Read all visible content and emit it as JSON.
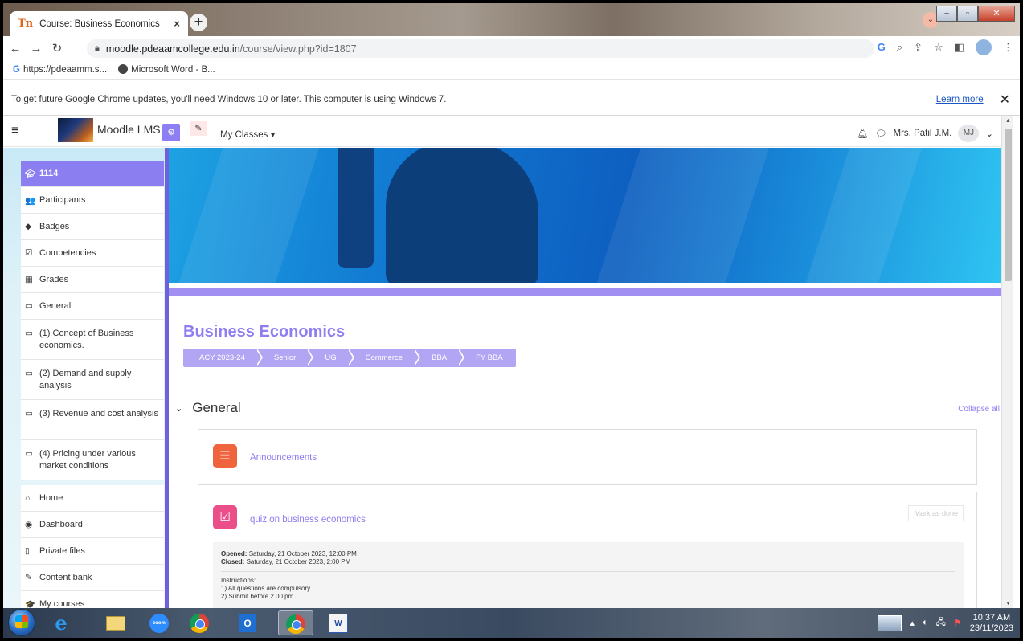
{
  "browser": {
    "tab_title": "Course: Business Economics",
    "tab_favicon": "Tn",
    "tab_close": "×",
    "new_tab": "+",
    "url_host": "moodle.pdeaamcollege.edu.in",
    "url_path": "/course/view.php?id=1807",
    "bookmarks": [
      {
        "label": "https://pdeaamm.s..."
      },
      {
        "label": "Microsoft Word - B..."
      }
    ],
    "infobar_message": "To get future Google Chrome updates, you'll need Windows 10 or later. This computer is using Windows 7.",
    "infobar_link": "Learn more",
    "infobar_close": "✕"
  },
  "moodle": {
    "brand": "Moodle LMS.",
    "my_classes": "My Classes ▾",
    "user_name": "Mrs. Patil J.M.",
    "user_initials": "MJ",
    "user_caret": "⌄"
  },
  "drawer": {
    "course_code": "1114",
    "items_top": [
      {
        "label": "Participants",
        "icon": "users-icon",
        "glyph": "👥"
      },
      {
        "label": "Badges",
        "icon": "shield-icon",
        "glyph": "◆"
      },
      {
        "label": "Competencies",
        "icon": "check-square-icon",
        "glyph": "☑"
      },
      {
        "label": "Grades",
        "icon": "table-icon",
        "glyph": "▦"
      },
      {
        "label": "General",
        "icon": "folder-icon",
        "glyph": "▭"
      },
      {
        "label": "(1) Concept of Business economics.",
        "icon": "folder-icon",
        "glyph": "▭"
      },
      {
        "label": "(2) Demand and supply analysis",
        "icon": "folder-icon",
        "glyph": "▭"
      },
      {
        "label": "(3) Revenue and cost analysis",
        "icon": "folder-icon",
        "glyph": "▭"
      },
      {
        "label": "(4) Pricing under various market conditions",
        "icon": "folder-icon",
        "glyph": "▭"
      }
    ],
    "items_bottom": [
      {
        "label": "Home",
        "icon": "home-icon",
        "glyph": "⌂"
      },
      {
        "label": "Dashboard",
        "icon": "dashboard-icon",
        "glyph": "◉"
      },
      {
        "label": "Private files",
        "icon": "file-icon",
        "glyph": "▯"
      },
      {
        "label": "Content bank",
        "icon": "pen-icon",
        "glyph": "✎"
      },
      {
        "label": "My courses",
        "icon": "graduation-cap-icon",
        "glyph": "🎓"
      }
    ]
  },
  "course": {
    "title": "Business Economics",
    "breadcrumbs": [
      "ACY 2023-24",
      "Senior",
      "UG",
      "Commerce",
      "BBA",
      "FY BBA"
    ],
    "section_title": "General",
    "collapse_all": "Collapse all",
    "activities": {
      "announcements": {
        "name": "Announcements",
        "icon": "forum-icon"
      },
      "quiz": {
        "name": "quiz on business economics",
        "icon": "quiz-icon",
        "mark_as_done": "Mark as done",
        "opened_label": "Opened:",
        "opened_value": "Saturday, 21 October 2023, 12:00 PM",
        "closed_label": "Closed:",
        "closed_value": "Saturday, 21 October 2023, 2:00 PM",
        "instructions_title": "Instructions:",
        "instruction_1": "1) All questions are compulsory",
        "instruction_2": "2) Submit before 2.00 pm"
      }
    }
  },
  "taskbar": {
    "time": "10:37 AM",
    "date": "23/11/2023",
    "zoom_label": "zoom",
    "outlook_label": "O",
    "word_label": "W"
  }
}
